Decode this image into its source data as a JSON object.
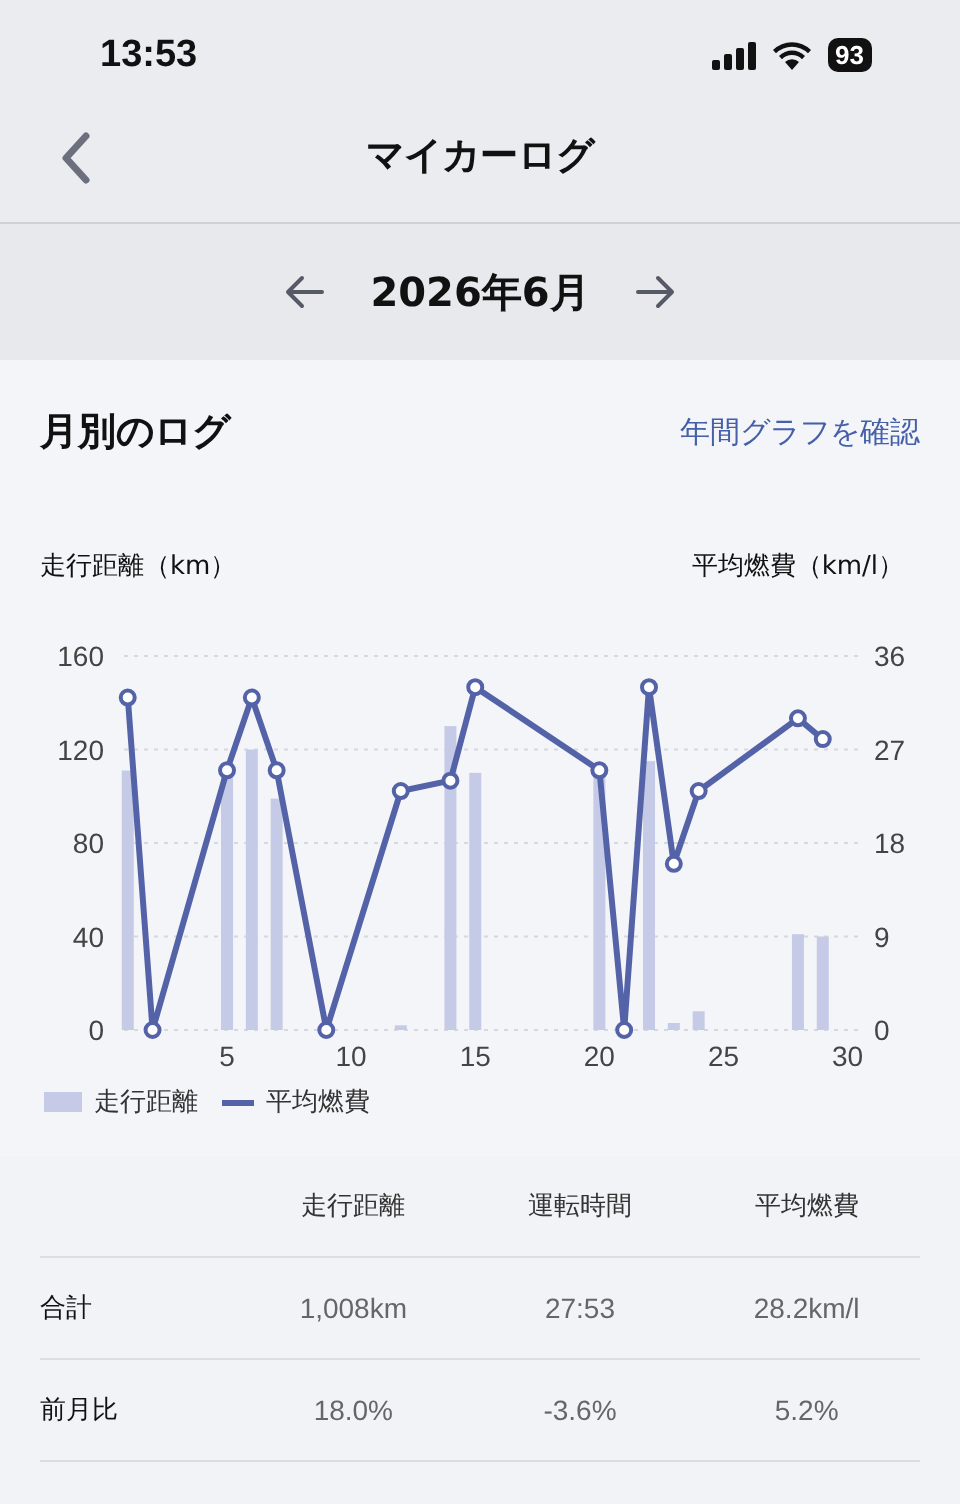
{
  "status_bar": {
    "time": "13:53",
    "battery": "93"
  },
  "nav": {
    "title": "マイカーログ"
  },
  "month_selector": {
    "label": "2026年6月"
  },
  "section": {
    "title": "月別のログ",
    "link": "年間グラフを確認"
  },
  "chart": {
    "left_axis_label": "走行距離（km）",
    "right_axis_label": "平均燃費（km/l）",
    "distance": {
      "chart_data": {
        "type": "bar",
        "x": [
          1,
          5,
          6,
          7,
          12,
          14,
          15,
          20,
          22,
          23,
          24,
          28,
          29
        ],
        "xlim": [
          0.85,
          30.5
        ],
        "xticks": [
          5,
          10,
          15,
          20,
          25,
          30
        ],
        "ylim": [
          0,
          160
        ],
        "yticks": [
          0,
          40,
          80,
          120,
          160
        ],
        "grid": true,
        "series": [
          {
            "name": "走行距離",
            "color": "#c5cae6",
            "values": [
              111,
              110,
              120,
              99,
              2,
              130,
              110,
              110,
              115,
              3,
              8,
              41,
              40
            ]
          }
        ]
      }
    },
    "fuel": {
      "chart_data": {
        "type": "line",
        "x": [
          1,
          2,
          5,
          6,
          7,
          9,
          12,
          14,
          15,
          20,
          21,
          22,
          23,
          24,
          28,
          29
        ],
        "xlim": [
          0.85,
          30.5
        ],
        "ylim": [
          0,
          36
        ],
        "yticks": [
          0,
          9,
          18,
          27,
          36
        ],
        "series": [
          {
            "name": "平均燃費",
            "color": "#5463a8",
            "marker": "circle",
            "values": [
              32,
              0,
              25,
              32,
              25,
              0,
              23,
              24,
              33,
              25,
              0,
              33,
              16,
              23,
              30,
              28
            ]
          }
        ]
      }
    }
  },
  "table": {
    "columns": [
      "走行距離",
      "運転時間",
      "平均燃費"
    ],
    "rows": [
      {
        "label": "合計",
        "cells": [
          "1,008km",
          "27:53",
          "28.2km/l"
        ]
      },
      {
        "label": "前月比",
        "cells": [
          "18.0%",
          "-3.6%",
          "5.2%"
        ]
      }
    ]
  }
}
